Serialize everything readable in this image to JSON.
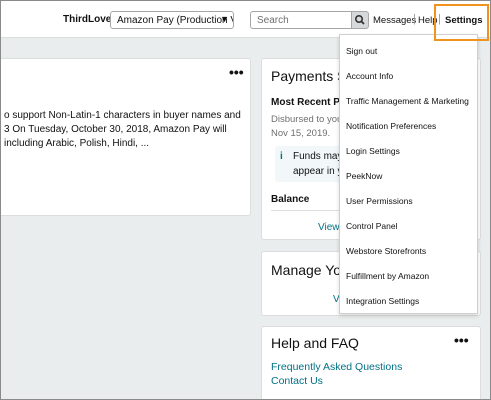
{
  "topbar": {
    "seller_name": "ThirdLove",
    "account_select": "Amazon Pay (Production V",
    "search_placeholder": "Search",
    "messages_label": "Messages",
    "help_label": "Help",
    "settings_label": "Settings",
    "separator": "|"
  },
  "message_card": {
    "menu_glyph": "•••",
    "lines": [
      "o support Non-Latin-1 characters in buyer names and",
      "3 On Tuesday, October 30, 2018, Amazon Pay will",
      "including Arabic, Polish, Hindi, ..."
    ]
  },
  "payments_card": {
    "title": "Payments S",
    "subtitle": "Most Recent P",
    "disbursed_line": "Disbursed to your",
    "date_line": "Nov 15, 2019.",
    "info_icon": "i",
    "info_lines": [
      "Funds may f",
      "appear in yo"
    ],
    "balance_label": "Balance",
    "view_link": "View"
  },
  "manage_card": {
    "title": "Manage You",
    "link": "V"
  },
  "help_card": {
    "title": "Help and FAQ",
    "menu_glyph": "•••",
    "links": [
      "Frequently Asked Questions",
      "Contact Us"
    ]
  },
  "settings_menu": {
    "items": [
      "Sign out",
      "Account Info",
      "Traffic Management & Marketing",
      "Notification Preferences",
      "Login Settings",
      "PeekNow",
      "User Permissions",
      "Control Panel",
      "Webstore Storefronts",
      "Fulfillment by Amazon",
      "Integration Settings"
    ]
  },
  "colors": {
    "background": "#eaeded",
    "link": "#007185",
    "highlight": "#f0921e",
    "info_box": "#f2f8fa"
  }
}
